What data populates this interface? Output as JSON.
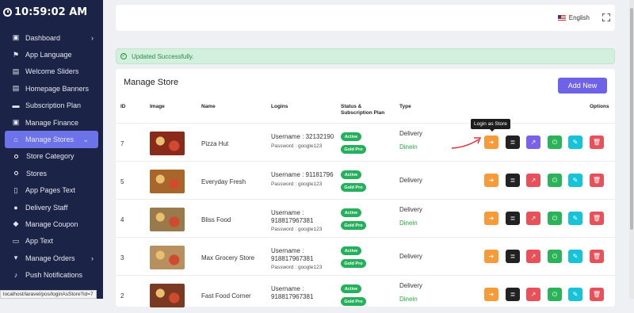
{
  "clock": "10:59:02 AM",
  "sidebar": {
    "items": [
      {
        "label": "Dashboard",
        "icon": "dashboard-icon",
        "glyph": "▣",
        "chevron": true
      },
      {
        "label": "App Language",
        "icon": "flag-icon",
        "glyph": "⚑"
      },
      {
        "label": "Welcome Sliders",
        "icon": "image-icon",
        "glyph": "▤"
      },
      {
        "label": "Homepage Banners",
        "icon": "image-icon",
        "glyph": "▤"
      },
      {
        "label": "Subscription Plan",
        "icon": "card-icon",
        "glyph": "▬"
      },
      {
        "label": "Manage Finance",
        "icon": "money-icon",
        "glyph": "▣"
      },
      {
        "label": "Manage Stores",
        "icon": "home-icon",
        "glyph": "⌂",
        "chevron": true,
        "active": true
      },
      {
        "label": "Store Category",
        "sub": true
      },
      {
        "label": "Stores",
        "sub": true
      },
      {
        "label": "App Pages Text",
        "icon": "document-icon",
        "glyph": "▯"
      },
      {
        "label": "Delivery Staff",
        "icon": "user-icon",
        "glyph": "●"
      },
      {
        "label": "Manage Coupon",
        "icon": "tag-icon",
        "glyph": "◆"
      },
      {
        "label": "App Text",
        "icon": "comment-icon",
        "glyph": "▭"
      },
      {
        "label": "Manage Orders",
        "icon": "cart-icon",
        "glyph": "▾",
        "chevron": true
      },
      {
        "label": "Push Notifications",
        "icon": "bell-icon",
        "glyph": "♪"
      }
    ]
  },
  "status_url": "localhost/laravel/pos/loginAsStore?id=7",
  "topbar": {
    "language": "English"
  },
  "alert": {
    "message": "Updated Successfully."
  },
  "main": {
    "title": "Manage Store",
    "add_new": "Add New",
    "columns": {
      "id": "ID",
      "image": "Image",
      "name": "Name",
      "logins": "Logins",
      "status": "Status &",
      "status2": "Subscription Plan",
      "type": "Type",
      "options": "Options"
    },
    "tooltip": "Login as Store",
    "rows": [
      {
        "id": "7",
        "name": "Pizza Hut",
        "login1": "Username : 32132190",
        "login2": "Password : google123",
        "status": "Active",
        "plan": "Gold Pro",
        "type1": "Delivery",
        "type2": "Dinein",
        "thumb_color": "#8a2a1a"
      },
      {
        "id": "5",
        "name": "Everyday Fresh",
        "login1": "Username : 91181796",
        "login2": "Password : google123",
        "status": "Active",
        "plan": "Gold Pro",
        "type1": "Delivery",
        "type2": "",
        "thumb_color": "#a8662a"
      },
      {
        "id": "4",
        "name": "Bliss Food",
        "login1": "Username :",
        "login1b": "918817967381",
        "login2": "Password : google123",
        "status": "Active",
        "plan": "Gold Pro",
        "type1": "Delivery",
        "type2": "Dinein",
        "thumb_color": "#9a7a4a"
      },
      {
        "id": "3",
        "name": "Max Grocery Store",
        "login1": "Username :",
        "login1b": "918817967381",
        "login2": "Password : google123",
        "status": "Active",
        "plan": "Gold Pro",
        "type1": "Delivery",
        "type2": "",
        "thumb_color": "#b89060"
      },
      {
        "id": "2",
        "name": "Fast Food Corner",
        "login1": "Username :",
        "login1b": "918817967381",
        "login2": "",
        "status": "Active",
        "plan": "Gold Pro",
        "type1": "Delivery",
        "type2": "Dinein",
        "thumb_color": "#7a3a22"
      }
    ]
  },
  "colors": {
    "sidebar": "#1b2346",
    "accent": "#6c72e8",
    "success": "#25b05b"
  }
}
